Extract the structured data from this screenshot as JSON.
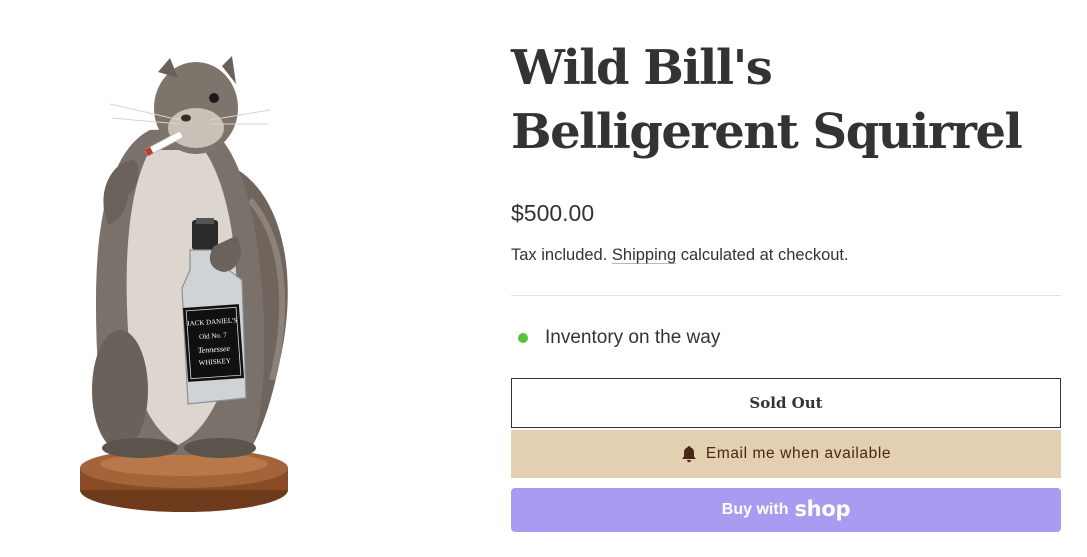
{
  "product": {
    "title": "Wild Bill's Belligerent Squirrel",
    "price": "$500.00",
    "tax_text": "Tax included.",
    "shipping_link": "Shipping",
    "tax_suffix": "calculated at checkout.",
    "image_icon": "squirrel-taxidermy-photo"
  },
  "bottle_label": {
    "line1": "JACK DANIEL'S",
    "line2": "Old No. 7",
    "line3": "Tennessee",
    "line4": "WHISKEY"
  },
  "inventory": {
    "text": "Inventory on the way",
    "dot_color": "#54c63a"
  },
  "buttons": {
    "sold_out": "Sold Out",
    "notify": "Email me when available",
    "notify_icon": "bell-icon",
    "notify_bg": "#e3d0b0",
    "notify_text_color": "#4a2616",
    "shop_prefix": "Buy with",
    "shop_logo": "shop",
    "shop_bg": "#a89cf0"
  }
}
